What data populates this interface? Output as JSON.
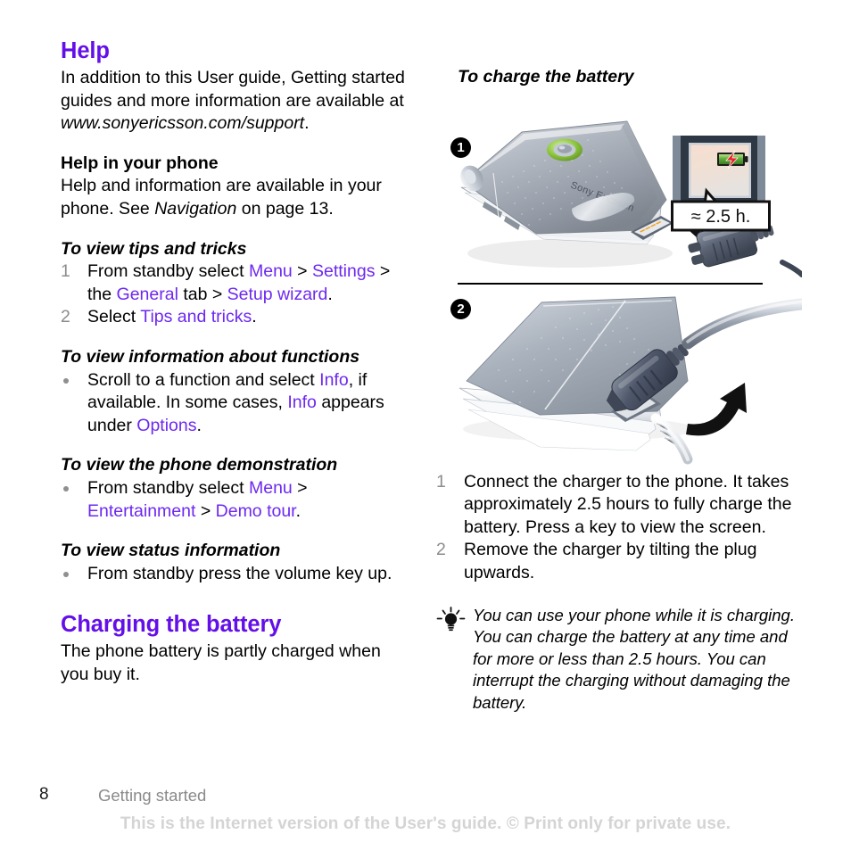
{
  "left_column": {
    "heading": "Help",
    "intro": {
      "text_before": "In addition to this User guide, Getting started guides and more information are available at ",
      "url": "www.sonyericsson.com/support",
      "text_after": "."
    },
    "subsection_heading": "Help in your phone",
    "subsection_body": {
      "part1": "Help and information are available in your phone. See ",
      "italic": "Navigation",
      "part2": " on page 13."
    },
    "proc1": {
      "title": "To view tips and tricks",
      "steps": [
        {
          "number": "1",
          "segments": [
            {
              "text": "From standby select ",
              "style": "plain"
            },
            {
              "text": "Menu",
              "style": "link"
            },
            {
              "text": " > ",
              "style": "plain"
            },
            {
              "text": "Settings",
              "style": "link"
            },
            {
              "text": " > the ",
              "style": "plain"
            },
            {
              "text": "General",
              "style": "link"
            },
            {
              "text": " tab > ",
              "style": "plain"
            },
            {
              "text": "Setup wizard",
              "style": "link"
            },
            {
              "text": ".",
              "style": "plain"
            }
          ]
        },
        {
          "number": "2",
          "segments": [
            {
              "text": "Select ",
              "style": "plain"
            },
            {
              "text": "Tips and tricks",
              "style": "link"
            },
            {
              "text": ".",
              "style": "plain"
            }
          ]
        }
      ]
    },
    "proc2": {
      "title": "To view information about functions",
      "bullets": [
        {
          "segments": [
            {
              "text": "Scroll to a function and select ",
              "style": "plain"
            },
            {
              "text": "Info",
              "style": "link"
            },
            {
              "text": ", if available. In some cases, ",
              "style": "plain"
            },
            {
              "text": "Info",
              "style": "link"
            },
            {
              "text": " appears under ",
              "style": "plain"
            },
            {
              "text": "Options",
              "style": "link"
            },
            {
              "text": ".",
              "style": "plain"
            }
          ]
        }
      ]
    },
    "proc3": {
      "title": "To view the phone demonstration",
      "bullets": [
        {
          "segments": [
            {
              "text": "From standby select ",
              "style": "plain"
            },
            {
              "text": "Menu",
              "style": "link"
            },
            {
              "text": " > ",
              "style": "plain"
            },
            {
              "text": "Entertainment",
              "style": "link"
            },
            {
              "text": " > ",
              "style": "plain"
            },
            {
              "text": "Demo tour",
              "style": "link"
            },
            {
              "text": ".",
              "style": "plain"
            }
          ]
        }
      ]
    },
    "proc4": {
      "title": "To view status information",
      "bullets": [
        {
          "segments": [
            {
              "text": "From standby press the volume key up.",
              "style": "plain"
            }
          ]
        }
      ]
    },
    "heading2": "Charging the battery",
    "body2": "The phone battery is partly charged when you buy it."
  },
  "right_column": {
    "proc_title": "To charge the battery",
    "figure1": {
      "step_label": "1",
      "phone_brand": "Sony Ericsson",
      "callout_text": "≈ 2.5 h.",
      "screen_icon": "battery-charging-icon"
    },
    "figure2": {
      "step_label": "2",
      "arrow_icon": "curved-arrow-up-icon"
    },
    "steps": [
      {
        "number": "1",
        "text": "Connect the charger to the phone. It takes approximately 2.5 hours to fully charge the battery. Press a key to view the screen."
      },
      {
        "number": "2",
        "text": "Remove the charger by tilting the plug upwards."
      }
    ],
    "tip": {
      "icon": "lightbulb-icon",
      "text": "You can use your phone while it is charging. You can charge the battery at any time and for more or less than 2.5 hours. You can interrupt the charging without damaging the battery."
    }
  },
  "footer": {
    "page_number": "8",
    "chapter": "Getting started",
    "watermark": "This is the Internet version of the User's guide. © Print only for private use."
  },
  "colors": {
    "heading_violet": "#6310e8",
    "link_violet": "#6d28f0",
    "marker_gray": "#8c8c8c",
    "watermark_gray": "#d4d4d4"
  }
}
